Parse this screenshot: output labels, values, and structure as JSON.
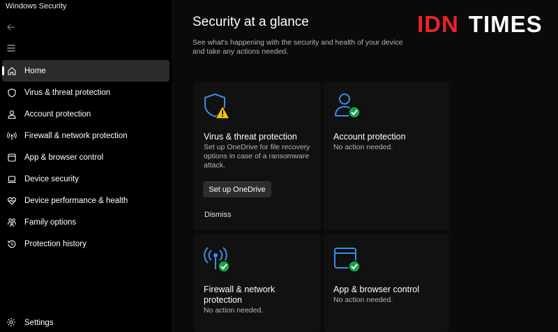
{
  "window": {
    "title": "Windows Security"
  },
  "brand": {
    "part1": "IDN",
    "part2": "TIMES"
  },
  "sidebar": {
    "items": [
      {
        "label": "Home",
        "icon": "home-icon",
        "active": true
      },
      {
        "label": "Virus & threat protection",
        "icon": "shield-icon"
      },
      {
        "label": "Account protection",
        "icon": "person-icon"
      },
      {
        "label": "Firewall & network protection",
        "icon": "antenna-icon"
      },
      {
        "label": "App & browser control",
        "icon": "app-window-icon"
      },
      {
        "label": "Device security",
        "icon": "laptop-icon"
      },
      {
        "label": "Device performance & health",
        "icon": "heart-pulse-icon"
      },
      {
        "label": "Family options",
        "icon": "family-icon"
      },
      {
        "label": "Protection history",
        "icon": "history-icon"
      }
    ],
    "settings_label": "Settings"
  },
  "main": {
    "title": "Security at a glance",
    "description": "See what's happening with the security and health of your device and take any actions needed.",
    "cards": [
      {
        "title": "Virus & threat protection",
        "text": "Set up OneDrive for file recovery options in case of a ransomware attack.",
        "button": "Set up OneDrive",
        "link": "Dismiss",
        "status": "warning"
      },
      {
        "title": "Account protection",
        "text": "No action needed.",
        "status": "ok"
      },
      {
        "title": "Firewall & network protection",
        "text": "No action needed.",
        "status": "ok"
      },
      {
        "title": "App & browser control",
        "text": "No action needed.",
        "status": "ok"
      }
    ]
  },
  "colors": {
    "accent_blue": "#3a8ee6",
    "warning_yellow": "#f7c400",
    "ok_green": "#16a34a",
    "brand_red": "#e8232a"
  }
}
